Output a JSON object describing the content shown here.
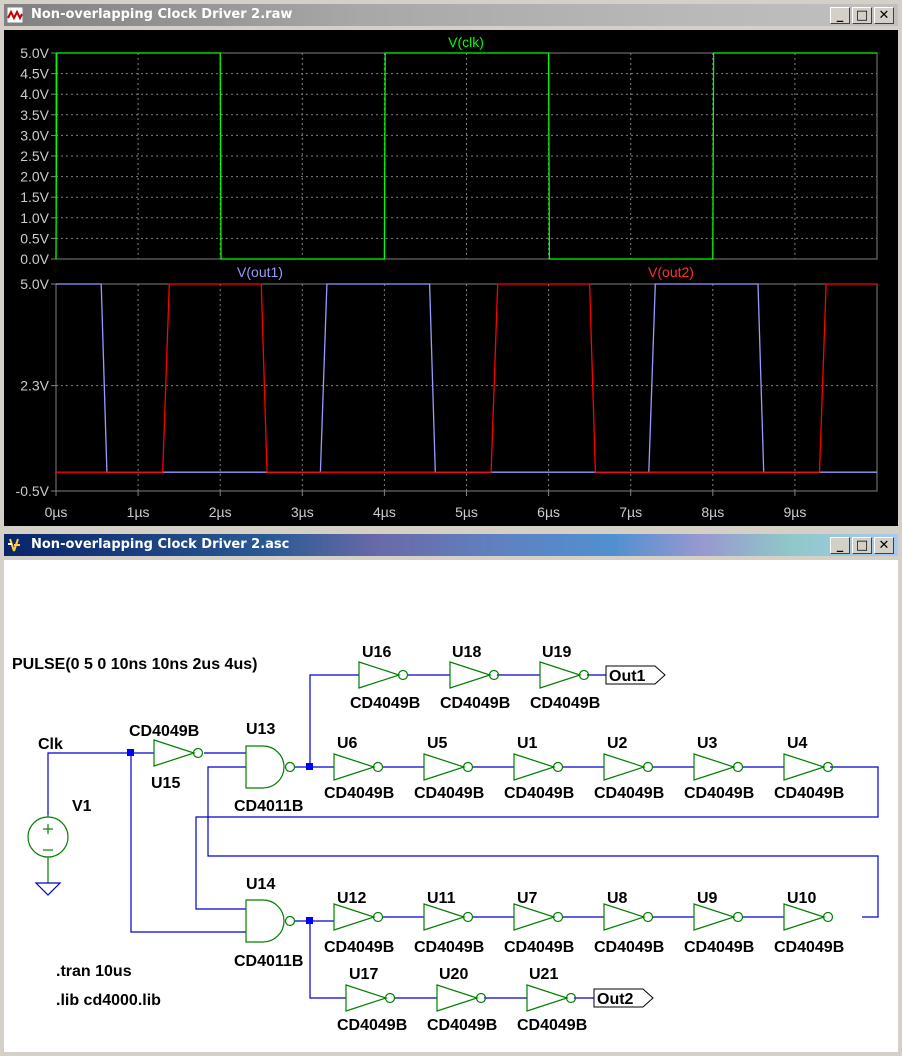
{
  "waveform_window": {
    "title": "Non-overlapping Clock Driver 2.raw",
    "buttons": {
      "minimize": "_",
      "maximize": "□",
      "close": "✕"
    },
    "pane1": {
      "trace_label": "V(clk)",
      "y_ticks": [
        "5.0V",
        "4.5V",
        "4.0V",
        "3.5V",
        "3.0V",
        "2.5V",
        "2.0V",
        "1.5V",
        "1.0V",
        "0.5V",
        "0.0V"
      ]
    },
    "pane2": {
      "trace_labels": [
        "V(out1)",
        "V(out2)"
      ],
      "y_ticks": [
        "5.0V",
        "2.3V",
        "-0.5V"
      ]
    },
    "x_ticks": [
      "0µs",
      "1µs",
      "2µs",
      "3µs",
      "4µs",
      "5µs",
      "6µs",
      "7µs",
      "8µs",
      "9µs"
    ],
    "colors": {
      "background": "#000000",
      "grid": "#808080",
      "clk": "#00ff00",
      "out1": "#9999ff",
      "out2": "#ff0000",
      "label": "#cccccc"
    }
  },
  "chart_data": [
    {
      "type": "line",
      "title": "",
      "xlabel": "",
      "ylabel": "",
      "xlim": [
        0,
        10
      ],
      "ylim": [
        0,
        5
      ],
      "x_unit": "µs",
      "series": [
        {
          "name": "V(clk)",
          "x": [
            0,
            0.01,
            2,
            2.01,
            4,
            4.01,
            6,
            6.01,
            8,
            8.01,
            10
          ],
          "y": [
            0,
            5,
            5,
            0,
            0,
            5,
            5,
            0,
            0,
            5,
            5
          ]
        }
      ]
    },
    {
      "type": "line",
      "title": "",
      "xlabel": "",
      "ylabel": "",
      "xlim": [
        0,
        10
      ],
      "ylim": [
        -0.5,
        5
      ],
      "x_unit": "µs",
      "series": [
        {
          "name": "V(out1)",
          "x": [
            0,
            0.55,
            0.62,
            3.22,
            3.3,
            4.55,
            4.62,
            7.22,
            7.3,
            8.55,
            8.62,
            10
          ],
          "y": [
            5,
            5,
            0,
            0,
            5,
            5,
            0,
            0,
            5,
            5,
            0,
            0
          ]
        },
        {
          "name": "V(out2)",
          "x": [
            0,
            1.3,
            1.38,
            2.5,
            2.57,
            5.3,
            5.38,
            6.5,
            6.57,
            9.3,
            9.38,
            10
          ],
          "y": [
            0,
            0,
            5,
            5,
            0,
            0,
            5,
            5,
            0,
            0,
            5,
            5
          ]
        }
      ]
    }
  ],
  "schematic_window": {
    "title": "Non-overlapping Clock Driver 2.asc",
    "buttons": {
      "minimize": "_",
      "maximize": "□",
      "close": "✕"
    },
    "source": {
      "value": "PULSE(0 5 0 10ns 10ns 2us 4us)",
      "name": "V1",
      "net": "Clk"
    },
    "directives": [
      ".tran 10us",
      ".lib cd4000.lib"
    ],
    "gates": {
      "u13": "U13",
      "u14": "U14",
      "type": "CD4011B"
    },
    "inverter_type": "CD4049B",
    "u15": "U15",
    "chain_out1": [
      "U16",
      "U18",
      "U19"
    ],
    "chain_row1": [
      "U6",
      "U5",
      "U1",
      "U2",
      "U3",
      "U4"
    ],
    "chain_row2": [
      "U12",
      "U11",
      "U7",
      "U8",
      "U9",
      "U10"
    ],
    "chain_out2": [
      "U17",
      "U20",
      "U21"
    ],
    "ports": {
      "out1": "Out1",
      "out2": "Out2"
    },
    "colors": {
      "wire": "#0000cd",
      "component": "#008000",
      "text": "#000000",
      "junction": "#0000ff"
    }
  }
}
